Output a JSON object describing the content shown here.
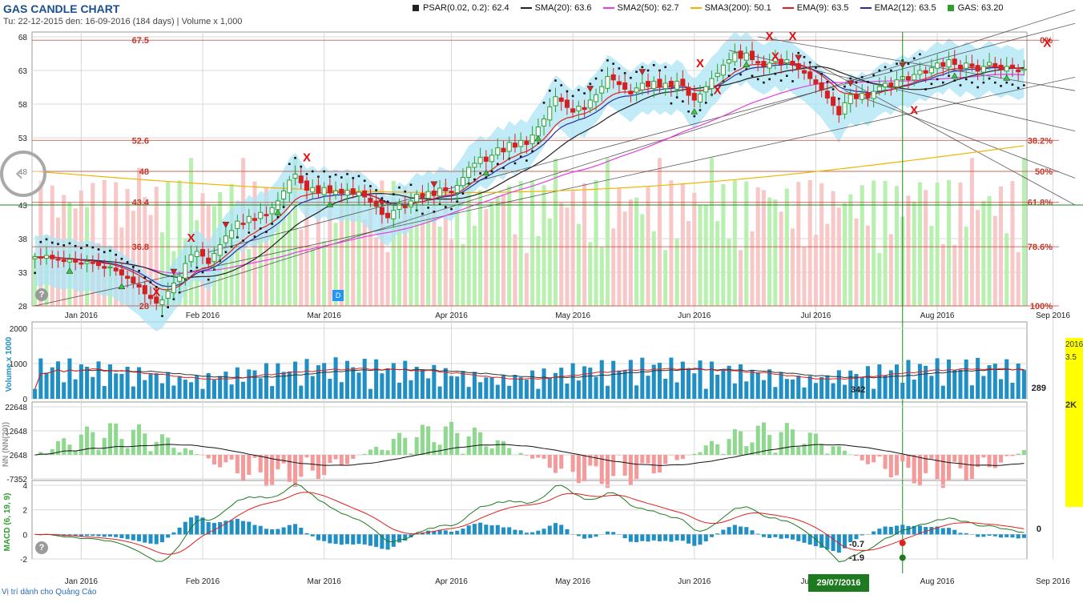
{
  "header": {
    "title": "GAS CANDLE CHART",
    "subtitle": "Tu: 22-12-2015 den: 16-09-2016 (184 days) | Volume x 1,000"
  },
  "legend": [
    {
      "label": "PSAR(0.02, 0.2): 62.4",
      "color": "#222222",
      "kind": "square"
    },
    {
      "label": "SMA(20): 63.6",
      "color": "#222222",
      "kind": "line"
    },
    {
      "label": "SMA2(50): 62.7",
      "color": "#e23ee2",
      "kind": "line"
    },
    {
      "label": "SMA3(200): 50.1",
      "color": "#f0b400",
      "kind": "line"
    },
    {
      "label": "EMA(9): 63.5",
      "color": "#e02020",
      "kind": "line"
    },
    {
      "label": "EMA2(12): 63.5",
      "color": "#2a2aa0",
      "kind": "line"
    },
    {
      "label": "GAS: 63.20",
      "color": "#2e9e2e",
      "kind": "square"
    }
  ],
  "colors": {
    "up": "#2e9e2e",
    "down": "#d42020",
    "volume_bar": "#1f8fc4",
    "vol_up_bg": "#b8f0b0",
    "vol_down_bg": "#f8c8c8",
    "cloud": "#aee4f6",
    "fib": "#c0392b",
    "grid": "#d8d8d8",
    "crosshair": "#1a8a1a"
  },
  "x_axis_labels": [
    "Jan 2016",
    "Feb 2016",
    "Mar 2016",
    "Apr 2016",
    "May 2016",
    "Jun 2016",
    "Jul 2016",
    "Aug 2016",
    "Sep 2016"
  ],
  "price_axis_labels": [
    "68",
    "63",
    "58",
    "53",
    "48",
    "43",
    "38",
    "33",
    "28"
  ],
  "fib_left_labels": [
    "67.5",
    "52.6",
    "48",
    "43.4",
    "36.8",
    "28"
  ],
  "fib_right_labels": [
    "0%",
    "38.2%",
    "50%",
    "61.8%",
    "78.6%",
    "100%"
  ],
  "volume_axis_labels": [
    "2000",
    "1000",
    "0"
  ],
  "volume_axis_title": "Volume x 1000",
  "volume_value_labels": [
    "342",
    "289"
  ],
  "nn_axis_labels": [
    "22648",
    "12648",
    "2648",
    "-7352"
  ],
  "nn_axis_title": "NN (NN(20))",
  "macd_axis_labels": [
    "4",
    "2",
    "0",
    "-2"
  ],
  "macd_axis_title": "MACD (6, 19, 9)",
  "macd_value_labels": [
    "0",
    "-0.7",
    "-1.9"
  ],
  "crosshair_date": "29/07/2016",
  "ad_label": "Vị trí dành cho Quảng Cáo",
  "yellow_box_texts": [
    "2016",
    "3.5",
    "2K"
  ],
  "help_glyph": "?",
  "blue_marker": "D",
  "nav_glyph": "‹",
  "chart_data": {
    "type": "candlestick",
    "title": "GAS CANDLE CHART",
    "x_range": [
      "2015-12-22",
      "2016-09-16"
    ],
    "ylim": [
      28,
      68
    ],
    "grid": true,
    "legend_placement": "top",
    "months": [
      "Jan 2016",
      "Feb 2016",
      "Mar 2016",
      "Apr 2016",
      "May 2016",
      "Jun 2016",
      "Jul 2016",
      "Aug 2016",
      "Sep 2016"
    ],
    "close_series": [
      35.3,
      35.1,
      35.5,
      35.0,
      34.8,
      34.6,
      34.9,
      34.5,
      34.2,
      34.6,
      34.3,
      34.0,
      33.6,
      33.8,
      33.2,
      32.6,
      32.1,
      31.4,
      30.8,
      29.8,
      29.1,
      28.4,
      28.9,
      30.2,
      31.4,
      32.4,
      34.3,
      35.6,
      36.1,
      35.4,
      34.3,
      35.8,
      37.1,
      38.4,
      39.2,
      40.6,
      40.1,
      41.3,
      40.7,
      41.9,
      41.4,
      42.6,
      43.6,
      45.1,
      46.7,
      47.6,
      46.3,
      45.2,
      45.6,
      44.8,
      45.6,
      44.8,
      45.1,
      44.7,
      45.2,
      44.6,
      44.9,
      44.2,
      43.4,
      42.8,
      41.6,
      41.1,
      42.2,
      43.2,
      42.6,
      43.6,
      44.6,
      44.1,
      45.0,
      44.4,
      45.5,
      45.1,
      44.8,
      45.9,
      47.1,
      48.6,
      49.2,
      50.1,
      49.5,
      50.4,
      51.5,
      50.9,
      52.3,
      51.6,
      52.6,
      52.0,
      53.4,
      54.6,
      55.8,
      57.6,
      59.1,
      58.4,
      57.5,
      56.8,
      57.7,
      57.2,
      58.6,
      59.4,
      60.6,
      62.1,
      61.6,
      60.9,
      60.2,
      59.5,
      60.4,
      61.1,
      60.6,
      61.4,
      60.6,
      61.1,
      60.5,
      61.4,
      60.8,
      59.3,
      58.6,
      59.5,
      60.6,
      61.8,
      62.6,
      63.8,
      64.6,
      65.6,
      64.8,
      65.6,
      64.6,
      64.1,
      63.6,
      64.1,
      64.9,
      63.9,
      64.6,
      63.8,
      63.2,
      62.6,
      61.8,
      61.0,
      60.1,
      58.9,
      57.8,
      56.4,
      58.2,
      59.4,
      58.8,
      59.6,
      58.9,
      59.9,
      60.6,
      61.1,
      60.6,
      61.6,
      62.1,
      61.6,
      62.4,
      63.0,
      62.6,
      63.4,
      64.1,
      63.6,
      64.6,
      63.9,
      63.2,
      64.1,
      63.6,
      62.9,
      63.6,
      64.2,
      63.6,
      63.1,
      63.6,
      63.3,
      62.8,
      63.2
    ],
    "fib_levels": [
      {
        "price": 67.5,
        "ratio": "0%"
      },
      {
        "price": 52.6,
        "ratio": "38.2%"
      },
      {
        "price": 48,
        "ratio": "50%"
      },
      {
        "price": 43.4,
        "ratio": "61.8%"
      },
      {
        "price": 36.8,
        "ratio": "78.6%"
      },
      {
        "price": 28,
        "ratio": "100%"
      }
    ],
    "indicators": {
      "psar": 62.4,
      "sma20": 63.6,
      "sma50": 62.7,
      "sma200": 50.1,
      "ema9": 63.5,
      "ema12": 63.5,
      "last": 63.2
    },
    "volume": {
      "ylim": [
        0,
        2000
      ],
      "last": 289,
      "marker": 342
    },
    "nn": {
      "ylim": [
        -7352,
        22648
      ]
    },
    "macd": {
      "params": "6, 19, 9",
      "ylim": [
        -2,
        4
      ],
      "values": {
        "signal_hist": 0,
        "macd_at_cursor": -0.7,
        "signal_at_cursor": -1.9
      }
    },
    "crosshair": {
      "date": "29/07/2016",
      "price": 43
    }
  }
}
